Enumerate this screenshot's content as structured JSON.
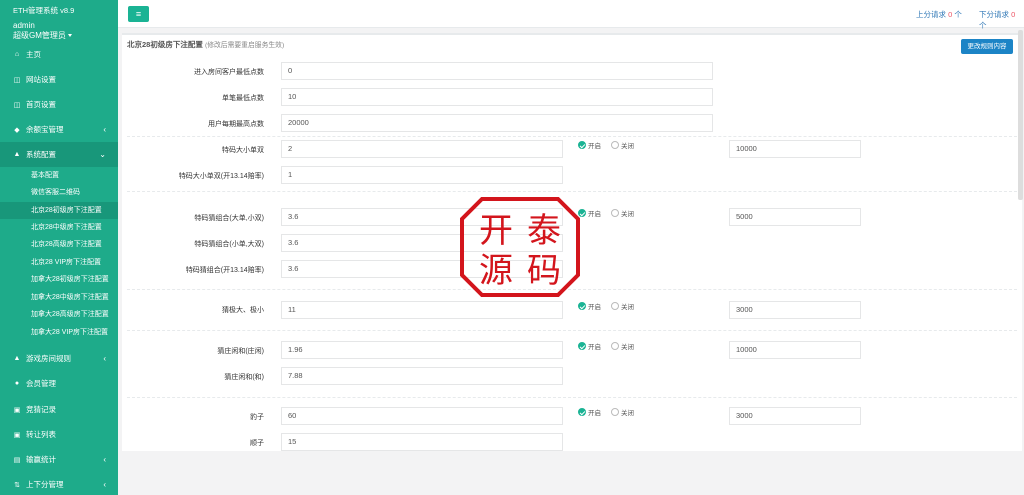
{
  "brand": {
    "title": "ETH管理系统 v8.9",
    "user": "admin",
    "role": "超级GM管理员"
  },
  "nav": {
    "home": "主页",
    "site": "网站设置",
    "homepage": "首页设置",
    "yuebao": "余额宝管理",
    "sys": "系统配置",
    "subs": [
      "基本配置",
      "微信客服二维码",
      "北京28初级房下注配置",
      "北京28中级房下注配置",
      "北京28高级房下注配置",
      "北京28 VIP房下注配置",
      "加拿大28初级房下注配置",
      "加拿大28中级房下注配置",
      "加拿大28高级房下注配置",
      "加拿大28 VIP房下注配置"
    ],
    "rules": "游戏房间规则",
    "members": "会员管理",
    "bets": "竞猜记录",
    "stats": "转让列表",
    "reports": "输赢统计",
    "updown": "上下分管理"
  },
  "topbar": {
    "up_label": "上分请求",
    "up_count": "0",
    "down_label": "下分请求",
    "down_count": "0",
    "unit": "个"
  },
  "panel": {
    "title": "北京28初级房下注配置",
    "note": "(修改后需要重启服务生效)",
    "save": "更改规则内容",
    "fields": [
      {
        "label": "进入房间客户最低点数",
        "value": "0"
      },
      {
        "label": "单笔最低点数",
        "value": "10"
      },
      {
        "label": "用户每期最高点数",
        "value": "20000"
      },
      {
        "label": "特码大小单双",
        "value": "2"
      },
      {
        "label": "特码大小单双(开13.14赔率)",
        "value": "1"
      },
      {
        "label": "特码猜组合(大单,小双)",
        "value": "3.6"
      },
      {
        "label": "特码猜组合(小单,大双)",
        "value": "3.6"
      },
      {
        "label": "特码猜组合(开13.14赔率)",
        "value": "3.6"
      },
      {
        "label": "猜极大、极小",
        "value": "11"
      },
      {
        "label": "猜庄闲和(庄闲)",
        "value": "1.96"
      },
      {
        "label": "猜庄闲和(和)",
        "value": "7.88"
      },
      {
        "label": "豹子",
        "value": "60"
      },
      {
        "label": "顺子",
        "value": "15"
      }
    ],
    "on": "开启",
    "off": "关闭",
    "limits": [
      "10000",
      "5000",
      "3000",
      "10000",
      "3000"
    ]
  },
  "stamp": {
    "chars": [
      "开",
      "泰",
      "源",
      "码"
    ]
  },
  "colors": {
    "sidebar": "#1eab8a",
    "accent": "#1ab394",
    "stamp": "#d3151c",
    "blue": "#1c84c6"
  }
}
